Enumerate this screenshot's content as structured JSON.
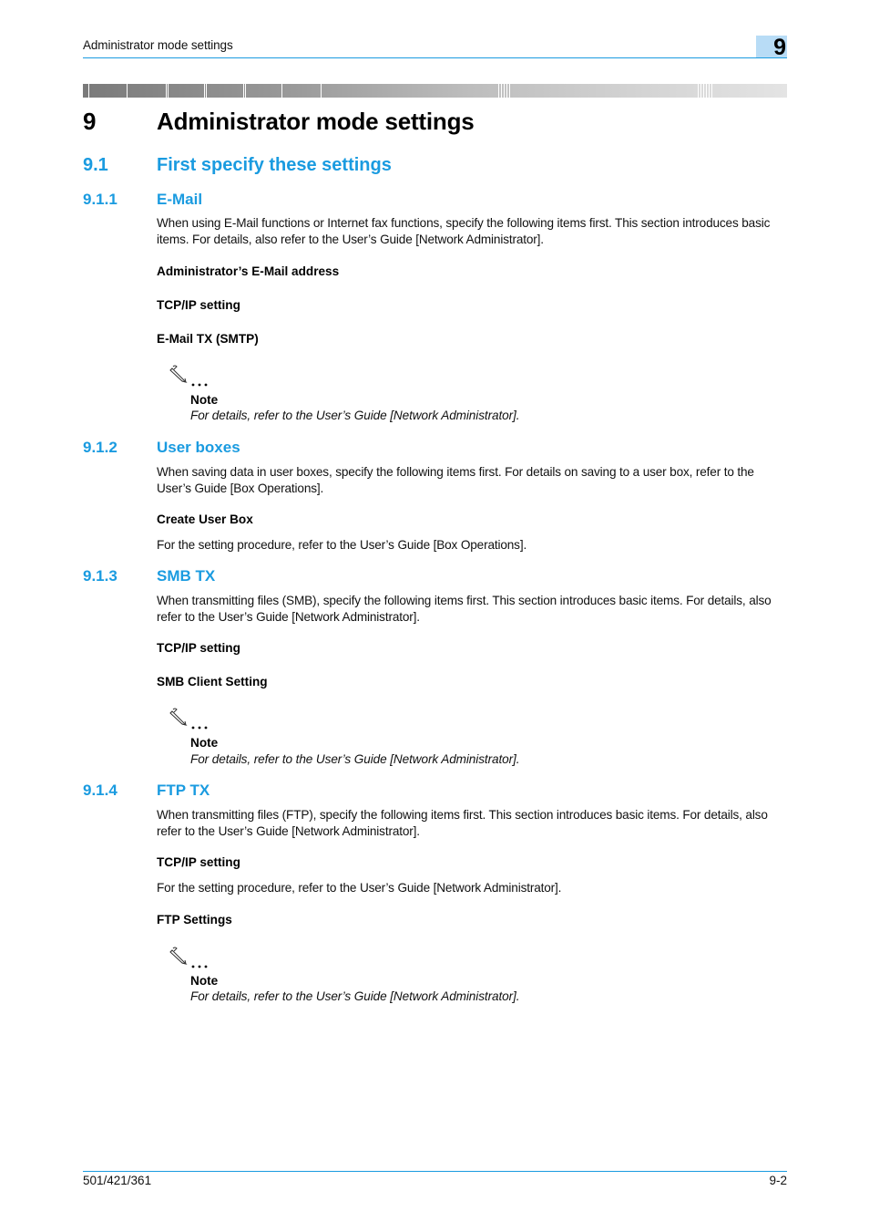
{
  "header": {
    "title": "Administrator mode settings",
    "chapter_badge": "9"
  },
  "chapter": {
    "number": "9",
    "title": "Administrator mode settings"
  },
  "section": {
    "number": "9.1",
    "title": "First specify these settings"
  },
  "subsections": [
    {
      "number": "9.1.1",
      "title": "E-Mail",
      "intro": "When using E-Mail functions or Internet fax functions, specify the following items first. This section introduces basic items. For details, also refer to the User’s Guide [Network Administrator].",
      "items": [
        "Administrator’s E-Mail address",
        "TCP/IP setting",
        "E-Mail TX (SMTP)"
      ],
      "note": {
        "icon": "pencil-note-icon",
        "label": "Note",
        "text": "For details, refer to the User’s Guide [Network Administrator]."
      }
    },
    {
      "number": "9.1.2",
      "title": "User boxes",
      "intro": "When saving data in user boxes, specify the following items first. For details on saving to a user box, refer to the User’s Guide [Box Operations].",
      "items": [
        "Create User Box"
      ],
      "item_desc": "For the setting procedure, refer to the User’s Guide [Box Operations]."
    },
    {
      "number": "9.1.3",
      "title": "SMB TX",
      "intro": "When transmitting files (SMB), specify the following items first. This section introduces basic items. For details, also refer to the User’s Guide [Network Administrator].",
      "items": [
        "TCP/IP setting",
        "SMB Client Setting"
      ],
      "note": {
        "icon": "pencil-note-icon",
        "label": "Note",
        "text": "For details, refer to the User’s Guide [Network Administrator]."
      }
    },
    {
      "number": "9.1.4",
      "title": "FTP TX",
      "intro": "When transmitting files (FTP), specify the following items first. This section introduces basic items. For details, also refer to the User’s Guide [Network Administrator].",
      "items": [
        "TCP/IP setting",
        "FTP Settings"
      ],
      "item_desc": "For the setting procedure, refer to the User’s Guide [Network Administrator].",
      "note": {
        "icon": "pencil-note-icon",
        "label": "Note",
        "text": "For details, refer to the User’s Guide [Network Administrator]."
      }
    }
  ],
  "footer": {
    "model": "501/421/361",
    "page": "9-2"
  },
  "colors": {
    "accent": "#1a9be0",
    "badge_bg": "#b8dcf6"
  }
}
